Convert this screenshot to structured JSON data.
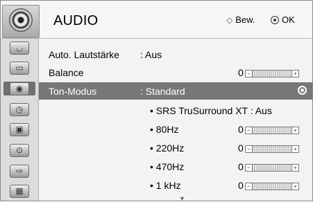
{
  "header": {
    "title": "AUDIO",
    "nav_hint": "Bew.",
    "ok_hint": "OK",
    "icon": "speaker-icon"
  },
  "sidebar": {
    "items": [
      {
        "icon": "antenna-dish-icon",
        "active": false
      },
      {
        "icon": "monitor-icon",
        "active": false
      },
      {
        "icon": "speaker-icon",
        "active": true
      },
      {
        "icon": "clock-icon",
        "active": false
      },
      {
        "icon": "briefcase-icon",
        "active": false
      },
      {
        "icon": "lock-icon",
        "active": false
      },
      {
        "icon": "input-cable-icon",
        "active": false
      },
      {
        "icon": "photo-icon",
        "active": false
      }
    ]
  },
  "rows": {
    "auto_volume": {
      "label": "Auto. Lautstärke",
      "value": ": Aus"
    },
    "balance": {
      "label": "Balance",
      "value": "0"
    },
    "sound_mode": {
      "label": "Ton-Modus",
      "value": ": Standard"
    },
    "srs": {
      "label": "• SRS TruSurround XT : Aus"
    },
    "eq": [
      {
        "label": "• 80Hz",
        "value": "0"
      },
      {
        "label": "• 220Hz",
        "value": "0"
      },
      {
        "label": "• 470Hz",
        "value": "0"
      },
      {
        "label": "• 1 kHz",
        "value": "0"
      }
    ]
  },
  "colors": {
    "selected_row": "#777777",
    "background": "#f3f3f3"
  }
}
